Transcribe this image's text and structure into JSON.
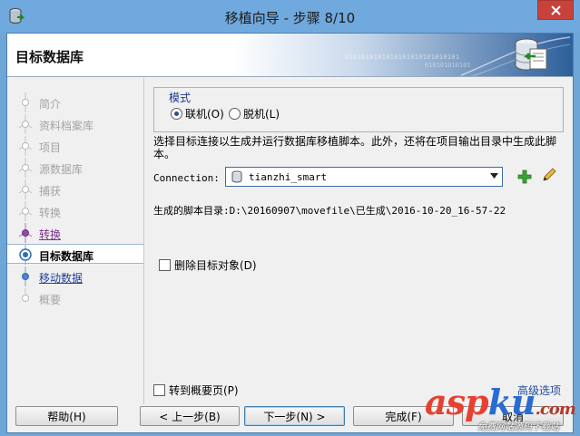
{
  "window": {
    "title": "移植向导 - 步骤 8/10"
  },
  "banner": {
    "title": "目标数据库",
    "binary_line1": "0101010101010101010101010101",
    "binary_line2": "010101010101"
  },
  "steps": [
    {
      "label": "简介",
      "state": "done"
    },
    {
      "label": "资料档案库",
      "state": "done"
    },
    {
      "label": "项目",
      "state": "done"
    },
    {
      "label": "源数据库",
      "state": "done"
    },
    {
      "label": "捕获",
      "state": "done"
    },
    {
      "label": "转换",
      "state": "done"
    },
    {
      "label": "转换",
      "state": "visited"
    },
    {
      "label": "目标数据库",
      "state": "current"
    },
    {
      "label": "移动数据",
      "state": "next"
    },
    {
      "label": "概要",
      "state": "future"
    }
  ],
  "mode": {
    "legend": "模式",
    "online_label": "联机(O)",
    "offline_label": "脱机(L)",
    "selected": "online"
  },
  "description": "选择目标连接以生成并运行数据库移植脚本。此外，还将在项目输出目录中生成此脚本。",
  "connection": {
    "label": "Connection:",
    "value": "tianzhi_smart",
    "add_icon": "plus-icon",
    "edit_icon": "pencil-icon"
  },
  "script_dir": {
    "text": "生成的脚本目录:D:\\20160907\\movefile\\已生成\\2016-10-20_16-57-22"
  },
  "drop_targets": {
    "label": "删除目标对象(D)",
    "checked": false
  },
  "goto_summary": {
    "label": "转到概要页(P)",
    "checked": false
  },
  "advanced_link": "高级选项",
  "buttons": {
    "help": "帮助(H)",
    "back": "< 上一步(B)",
    "next": "下一步(N) >",
    "finish": "完成(F)",
    "cancel": "取消"
  },
  "watermark": {
    "logo_asp": "asp",
    "logo_ku": "ku",
    "logo_net": ".com",
    "subtitle": "免费网站源码下载站"
  }
}
